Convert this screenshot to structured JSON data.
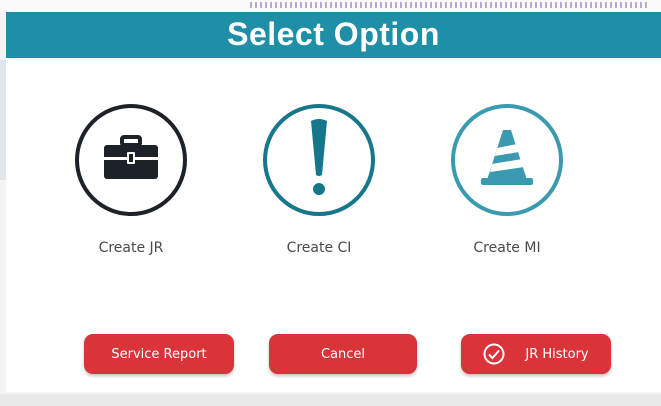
{
  "header": {
    "title": "Select Option"
  },
  "options": [
    {
      "label": "Create JR",
      "icon": "briefcase-icon"
    },
    {
      "label": "Create CI",
      "icon": "exclamation-icon"
    },
    {
      "label": "Create MI",
      "icon": "traffic-cone-icon"
    }
  ],
  "actions": {
    "service_report": "Service Report",
    "cancel": "Cancel",
    "jr_history": "JR History"
  },
  "colors": {
    "header_bg": "#1f8fa8",
    "button_bg": "#d9343a",
    "teal_dark": "#16778a",
    "teal_light": "#3a9bb0",
    "dark": "#1c2228"
  }
}
